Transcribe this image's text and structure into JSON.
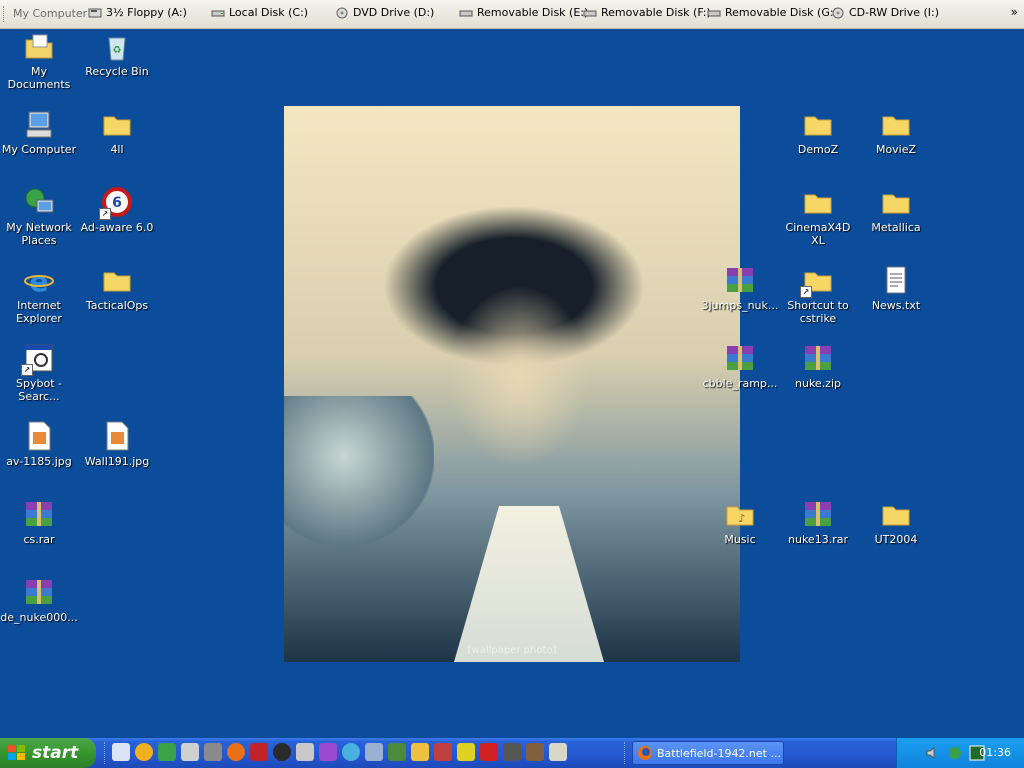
{
  "topbar": {
    "title": "My Computer",
    "drives": [
      {
        "label": "3½ Floppy (A:)",
        "icon": "floppy-drive-icon"
      },
      {
        "label": "Local Disk (C:)",
        "icon": "hard-disk-icon"
      },
      {
        "label": "DVD Drive (D:)",
        "icon": "dvd-drive-icon"
      },
      {
        "label": "Removable Disk (E:)",
        "icon": "removable-disk-icon"
      },
      {
        "label": "Removable Disk (F:)",
        "icon": "removable-disk-icon"
      },
      {
        "label": "Removable Disk (G:)",
        "icon": "removable-disk-icon"
      },
      {
        "label": "CD-RW Drive (I:)",
        "icon": "cdrw-drive-icon"
      }
    ],
    "overflow": "»"
  },
  "desktop": {
    "left": [
      {
        "label": "My Documents",
        "icon": "my-documents-icon"
      },
      {
        "label": "Recycle Bin",
        "icon": "recycle-bin-icon"
      },
      {
        "label": "My Computer",
        "icon": "my-computer-icon"
      },
      {
        "label": "4ll",
        "icon": "folder-icon"
      },
      {
        "label": "My Network Places",
        "icon": "network-places-icon"
      },
      {
        "label": "Ad-aware 6.0",
        "icon": "adaware-icon"
      },
      {
        "label": "Internet Explorer",
        "icon": "internet-explorer-icon"
      },
      {
        "label": "TacticalOps",
        "icon": "folder-icon"
      },
      {
        "label": "Spybot - Searc...",
        "icon": "spybot-icon"
      },
      {
        "label": "av-1185.jpg",
        "icon": "jpg-file-icon"
      },
      {
        "label": "Wall191.jpg",
        "icon": "jpg-file-icon"
      },
      {
        "label": "cs.rar",
        "icon": "rar-archive-icon"
      },
      {
        "label": "de_nuke000...",
        "icon": "rar-archive-icon"
      }
    ],
    "right": [
      {
        "label": "DemoZ",
        "icon": "folder-icon"
      },
      {
        "label": "MovieZ",
        "icon": "folder-icon"
      },
      {
        "label": "CinemaX4D XL",
        "icon": "folder-icon"
      },
      {
        "label": "Metallica",
        "icon": "folder-icon"
      },
      {
        "label": "3jumps_nuk...",
        "icon": "rar-archive-icon"
      },
      {
        "label": "Shortcut to cstrike",
        "icon": "folder-shortcut-icon"
      },
      {
        "label": "News.txt",
        "icon": "text-file-icon"
      },
      {
        "label": "cbble_ramp...",
        "icon": "rar-archive-icon"
      },
      {
        "label": "nuke.zip",
        "icon": "rar-archive-icon"
      },
      {
        "label": "Music",
        "icon": "music-folder-icon"
      },
      {
        "label": "nuke13.rar",
        "icon": "rar-archive-icon"
      },
      {
        "label": "UT2004",
        "icon": "folder-icon"
      }
    ]
  },
  "wallpaper": {
    "placeholder": "[wallpaper photo]"
  },
  "taskbar": {
    "start_label": "start",
    "quick_launch": [
      "show-desktop-icon",
      "media-player-icon",
      "lite-app-icon",
      "winamp-icon",
      "teamspeak-icon",
      "firefox-icon",
      "tool-icon",
      "steam-icon",
      "printer-icon",
      "paint-icon",
      "network-icon",
      "scissors-icon",
      "monster-icon",
      "pencil-icon",
      "spray-icon",
      "game-icon",
      "skull-icon",
      "alien-icon",
      "rifle-icon",
      "chat-icon"
    ],
    "task": {
      "label": "Battlefield-1942.net ...",
      "icon": "firefox-icon"
    },
    "tray": [
      "speaker-icon",
      "network-tray-icon",
      "lite-tray-icon"
    ],
    "clock": "01:36"
  },
  "colors": {
    "desktop": "#0b4c9b",
    "taskbar": "#2457d0",
    "start": "#37962f",
    "tray": "#0f84dc"
  }
}
